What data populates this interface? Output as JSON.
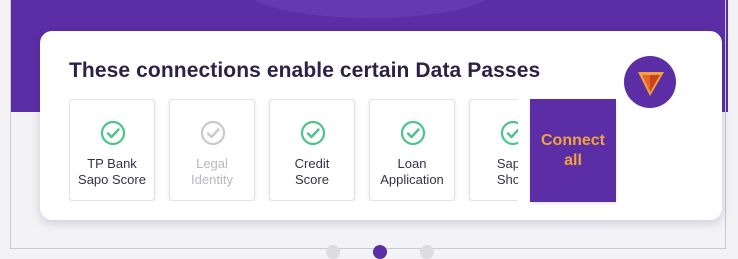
{
  "card": {
    "title": "These connections enable certain Data Passes"
  },
  "connections": [
    {
      "label": "TP Bank\nSapo Score",
      "status": "connected"
    },
    {
      "label": "Legal\nIdentity",
      "status": "disabled"
    },
    {
      "label": "Credit\nScore",
      "status": "connected"
    },
    {
      "label": "Loan\nApplication",
      "status": "connected"
    },
    {
      "label": "Sapo\nShop",
      "status": "connected"
    }
  ],
  "connect_all_label": "Connect\nall",
  "colors": {
    "brand_purple": "#5b2ea6",
    "accent_orange": "#f2a23c",
    "check_green": "#4cc38a",
    "check_disabled": "#c9c9cf"
  },
  "icons": {
    "check": "check-circle-icon",
    "logo": "triangle-logo-icon"
  }
}
